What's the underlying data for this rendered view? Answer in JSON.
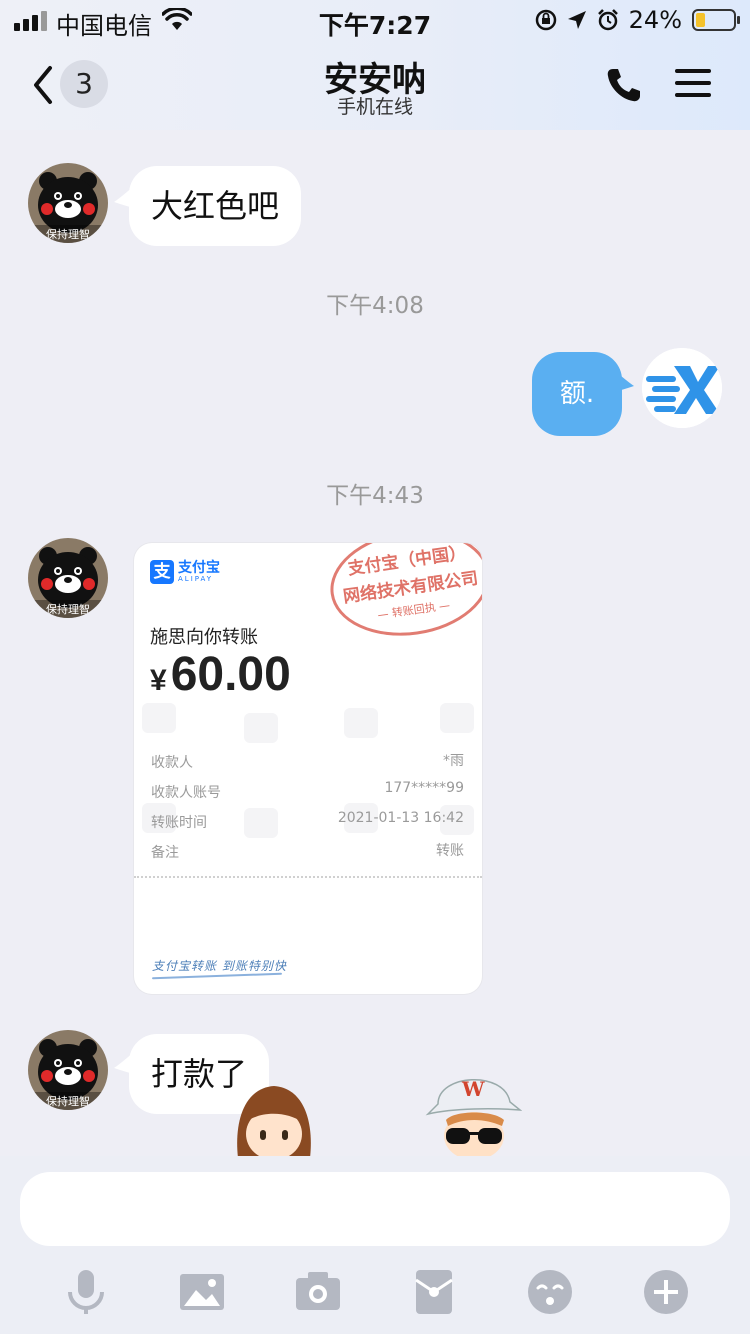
{
  "status_bar": {
    "carrier": "中国电信",
    "time": "下午7:27",
    "battery_percent": "24%",
    "battery_level": 0.24
  },
  "header": {
    "unread_count": "3",
    "contact_name": "安安呐",
    "contact_status": "手机在线"
  },
  "messages": {
    "m1_text": "大红色吧",
    "time1": "下午4:08",
    "m2_text": "额.",
    "time2": "下午4:43",
    "m4_text": "打款了"
  },
  "avatar_caption": "保持理智",
  "receipt": {
    "brand": "支付宝",
    "brand_en": "ALIPAY",
    "title": "施思向你转账",
    "currency": "¥",
    "amount": "60.00",
    "rows": [
      {
        "label": "收款人",
        "value": "*雨"
      },
      {
        "label": "收款人账号",
        "value": "177*****99"
      },
      {
        "label": "转账时间",
        "value": "2021-01-13 16:42"
      },
      {
        "label": "备注",
        "value": "转账"
      }
    ],
    "stamp_line1": "支付宝（中国）",
    "stamp_line2": "网络技术有限公司",
    "stamp_line3": "— 转账回执 —",
    "slogan": "支付宝转账 到账特别快"
  },
  "input": {
    "value": "",
    "placeholder": ""
  },
  "toolbar": [
    "mic-icon",
    "image-icon",
    "camera-icon",
    "red-packet-icon",
    "emoji-icon",
    "plus-icon"
  ],
  "colors": {
    "blue_bubble": "#5aaff1",
    "alipay_blue": "#1677ff",
    "stamp_red": "#d64a3c",
    "timestamp_gray": "#999999"
  }
}
